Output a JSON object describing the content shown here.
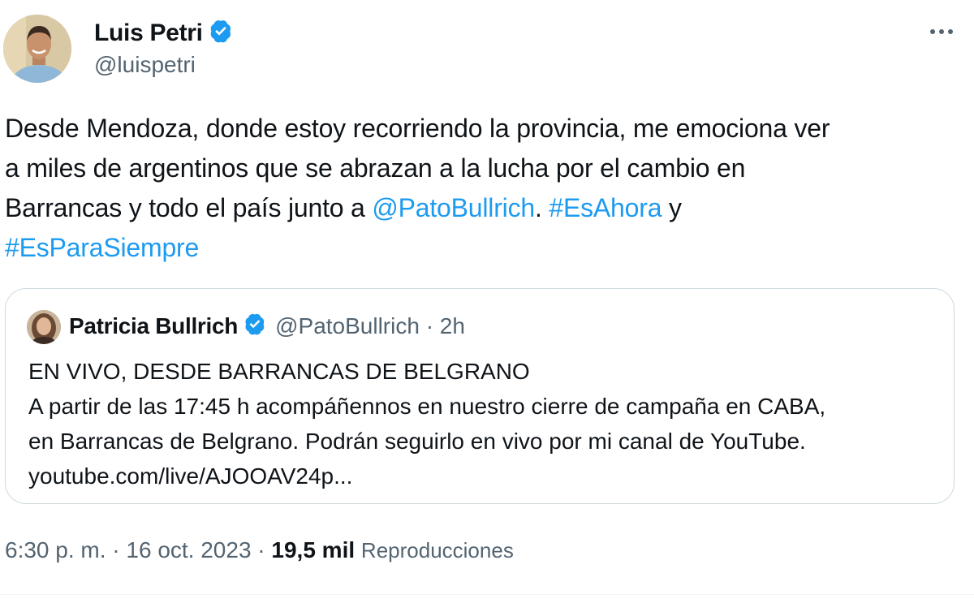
{
  "author": {
    "name": "Luis Petri",
    "handle": "@luispetri",
    "verified": true
  },
  "more_icon": "more-horizontal-icon",
  "tweet": {
    "line1": "Desde Mendoza, donde estoy recorriendo la provincia, me emociona ver",
    "line2": "a miles de argentinos que se abrazan a la lucha por el cambio en",
    "line3_prefix": "Barrancas y todo el país junto a ",
    "mention": "@PatoBullrich",
    "line3_sep": ". ",
    "hashtag1": "#EsAhora",
    "line3_suffix": " y",
    "hashtag2": "#EsParaSiempre"
  },
  "quote": {
    "name": "Patricia Bullrich",
    "verified": true,
    "handle_time": "@PatoBullrich · 2h",
    "line1": "EN VIVO, DESDE BARRANCAS DE BELGRANO",
    "line2": "A partir de las 17:45 h acompáñennos en nuestro cierre de campaña en CABA,",
    "line3": "en Barrancas de Belgrano. Podrán seguirlo en vivo por mi canal de YouTube.",
    "line4": "youtube.com/live/AJOOAV24p..."
  },
  "footer": {
    "time_date": "6:30 p. m. · 16 oct. 2023 · ",
    "views_count": "19,5 mil",
    "views_label": "Reproducciones"
  },
  "colors": {
    "link": "#1d9bf0",
    "secondary_text": "#536471",
    "primary_text": "#0f1419",
    "border": "#cfd9de",
    "verified": "#1d9bf0"
  }
}
